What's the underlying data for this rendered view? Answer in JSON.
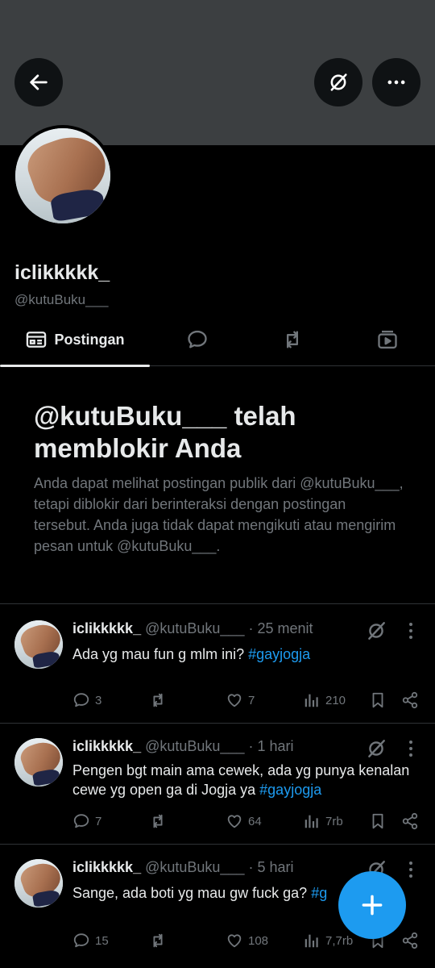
{
  "profile": {
    "display_name": "iclikkkkk_",
    "handle": "@kutuBuku___"
  },
  "tabs": [
    {
      "label": "Postingan",
      "icon": "posts-icon",
      "active": true
    },
    {
      "label": "",
      "icon": "reply-icon"
    },
    {
      "label": "",
      "icon": "repost-icon"
    },
    {
      "label": "",
      "icon": "media-icon"
    }
  ],
  "blocked_notice": {
    "title": "@kutuBuku___ telah memblokir Anda",
    "body": "Anda dapat melihat postingan publik dari @kutuBuku___, tetapi diblokir dari berinteraksi dengan postingan tersebut. Anda juga tidak dapat mengikuti atau mengirim pesan untuk @kutuBuku___."
  },
  "posts": [
    {
      "name": "iclikkkkk_",
      "meta": "@kutuBuku___ · 25 menit",
      "text": "Ada yg mau fun g mlm ini? ",
      "hashtag": "#gayjogja",
      "replies": "3",
      "reposts": "",
      "likes": "7",
      "views": "210"
    },
    {
      "name": "iclikkkkk_",
      "meta": "@kutuBuku___ · 1 hari",
      "text": "Pengen bgt main ama cewek, ada yg punya kenalan cewe yg open ga di Jogja ya ",
      "hashtag": "#gayjogja",
      "replies": "7",
      "reposts": "",
      "likes": "64",
      "views": "7rb"
    },
    {
      "name": "iclikkkkk_",
      "meta": "@kutuBuku___ · 5 hari",
      "text": "Sange, ada boti yg mau gw fuck ga? ",
      "hashtag": "#g",
      "replies": "15",
      "reposts": "",
      "likes": "108",
      "views": "7,7rb"
    }
  ],
  "colors": {
    "background": "#000000",
    "banner": "#3c3f41",
    "accent": "#1d9bf0",
    "text_primary": "#e7e9ea",
    "text_secondary": "#71767b",
    "divider": "#2f3336"
  }
}
